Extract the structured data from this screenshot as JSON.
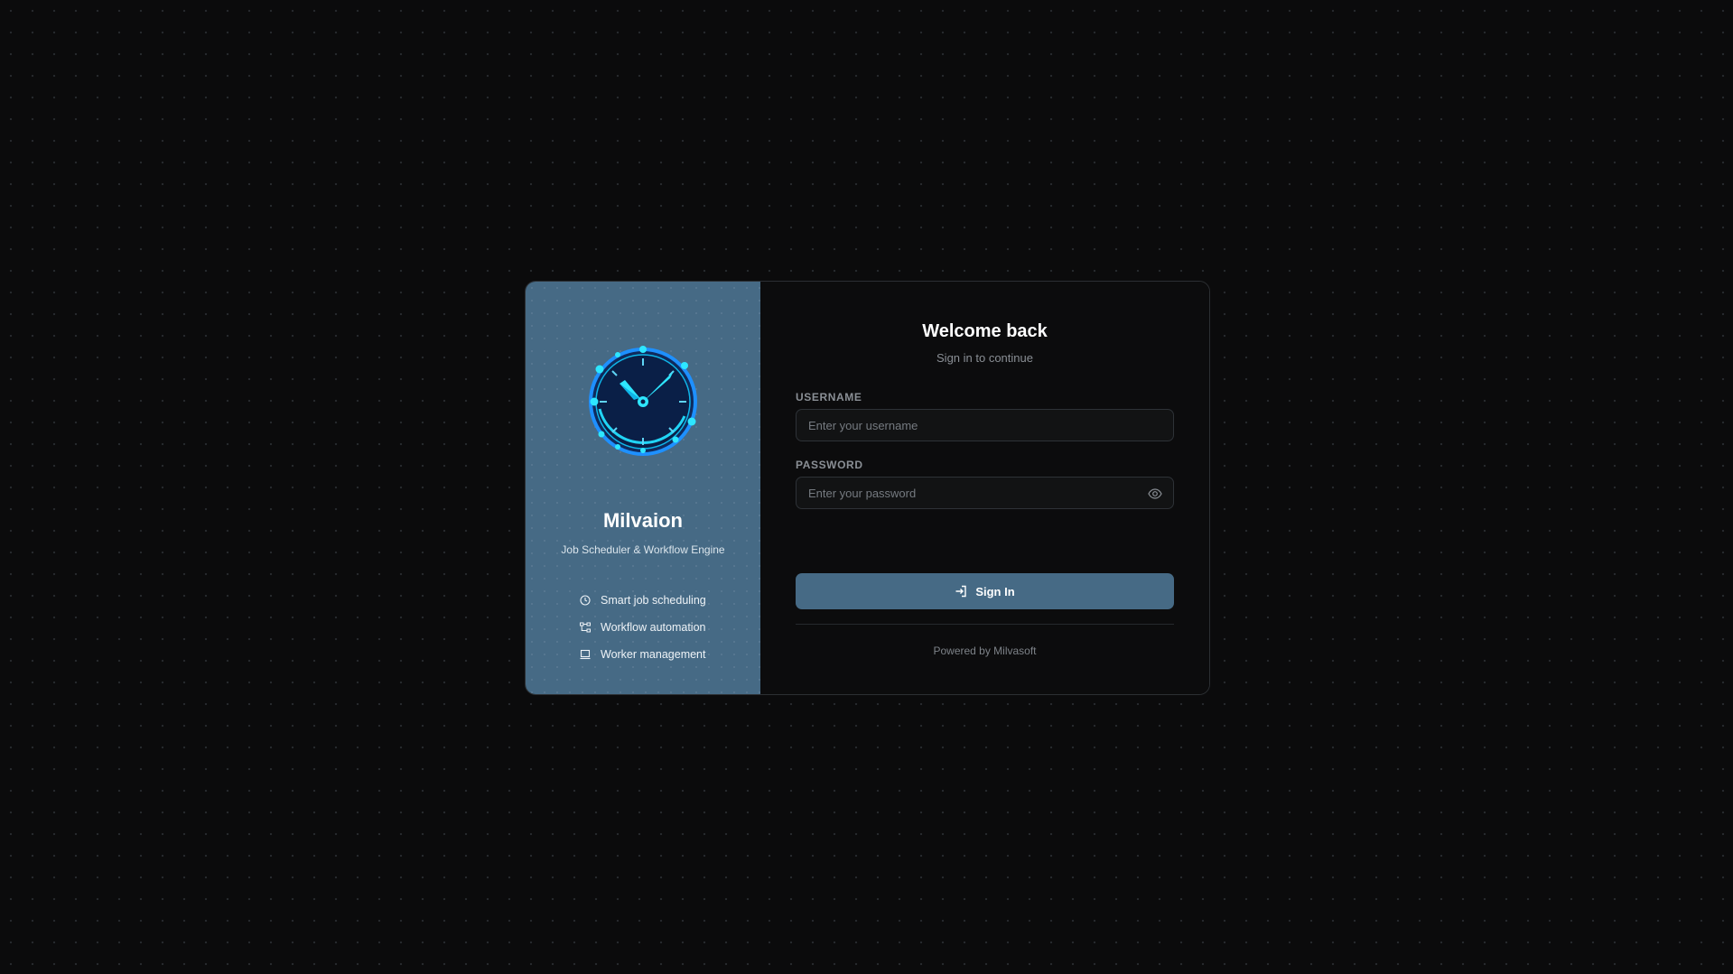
{
  "brand": {
    "name": "Milvaion",
    "tagline": "Job Scheduler & Workflow Engine",
    "logo_icon": "clock-logo-icon",
    "accent_color": "#466a85"
  },
  "features": [
    {
      "label": "Smart job scheduling",
      "icon": "clock-icon"
    },
    {
      "label": "Workflow automation",
      "icon": "workflow-icon"
    },
    {
      "label": "Worker management",
      "icon": "monitor-icon"
    }
  ],
  "login": {
    "heading": "Welcome back",
    "subheading": "Sign in to continue",
    "username_label": "USERNAME",
    "username_placeholder": "Enter your username",
    "username_value": "",
    "password_label": "PASSWORD",
    "password_placeholder": "Enter your password",
    "password_value": "",
    "password_toggle_icon": "eye-icon",
    "submit_label": "Sign In",
    "submit_icon": "sign-in-icon"
  },
  "footer": {
    "powered_by": "Powered by Milvasoft"
  }
}
